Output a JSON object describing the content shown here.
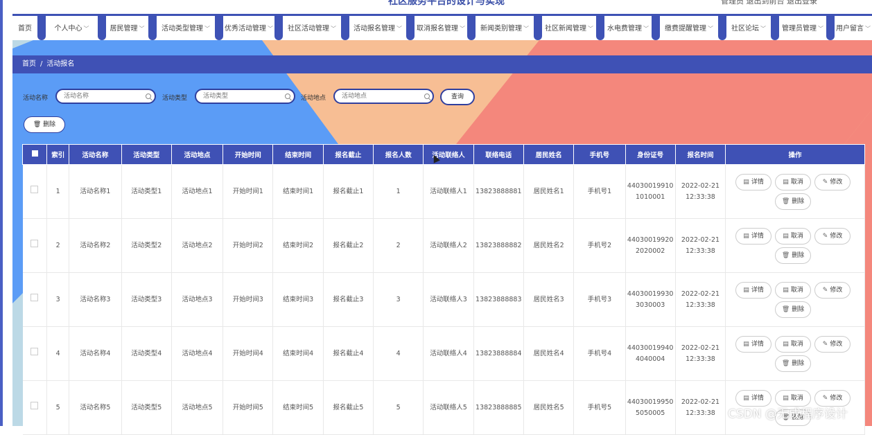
{
  "header": {
    "site_title": "社区服务平台的设计与实现",
    "top_right": "管理员   退出到前台   退出登录"
  },
  "nav": [
    {
      "label": "首页"
    },
    {
      "label": "个人中心"
    },
    {
      "label": "居民管理"
    },
    {
      "label": "活动类型管理"
    },
    {
      "label": "优秀活动管理"
    },
    {
      "label": "社区活动管理"
    },
    {
      "label": "活动报名管理"
    },
    {
      "label": "取消报名管理"
    },
    {
      "label": "新闻类别管理"
    },
    {
      "label": "社区新闻管理"
    },
    {
      "label": "水电费管理"
    },
    {
      "label": "缴费提醒管理"
    },
    {
      "label": "社区论坛"
    },
    {
      "label": "管理员管理"
    },
    {
      "label": "用户留言"
    }
  ],
  "breadcrumb": {
    "home": "首页",
    "separator": "/",
    "current": "活动报名"
  },
  "filters": {
    "name_label": "活动名称",
    "name_placeholder": "活动名称",
    "type_label": "活动类型",
    "type_placeholder": "活动类型",
    "place_label": "活动地点",
    "place_placeholder": "活动地点",
    "query_label": "查询"
  },
  "bulk": {
    "delete_label": "删除"
  },
  "table": {
    "headers": [
      "索引",
      "活动名称",
      "活动类型",
      "活动地点",
      "开始时间",
      "结束时间",
      "报名截止",
      "报名人数",
      "活动联络人",
      "联络电话",
      "居民姓名",
      "手机号",
      "身份证号",
      "报名时间",
      "操作"
    ],
    "rows": [
      [
        "1",
        "活动名称1",
        "活动类型1",
        "活动地点1",
        "开始时间1",
        "结束时间1",
        "报名截止1",
        "1",
        "活动联络人1",
        "13823888881",
        "居民姓名1",
        "手机号1",
        "440300199101010001",
        "2022-02-21 12:33:38"
      ],
      [
        "2",
        "活动名称2",
        "活动类型2",
        "活动地点2",
        "开始时间2",
        "结束时间2",
        "报名截止2",
        "2",
        "活动联络人2",
        "13823888882",
        "居民姓名2",
        "手机号2",
        "440300199202020002",
        "2022-02-21 12:33:38"
      ],
      [
        "3",
        "活动名称3",
        "活动类型3",
        "活动地点3",
        "开始时间3",
        "结束时间3",
        "报名截止3",
        "3",
        "活动联络人3",
        "13823888883",
        "居民姓名3",
        "手机号3",
        "440300199303030003",
        "2022-02-21 12:33:38"
      ],
      [
        "4",
        "活动名称4",
        "活动类型4",
        "活动地点4",
        "开始时间4",
        "结束时间4",
        "报名截止4",
        "4",
        "活动联络人4",
        "13823888884",
        "居民姓名4",
        "手机号4",
        "440300199404040004",
        "2022-02-21 12:33:38"
      ],
      [
        "5",
        "活动名称5",
        "活动类型5",
        "活动地点5",
        "开始时间5",
        "结束时间5",
        "报名截止5",
        "5",
        "活动联络人5",
        "13823888885",
        "居民姓名5",
        "手机号5",
        "440300199505050005",
        "2022-02-21 12:33:38"
      ]
    ],
    "actions": {
      "detail": "详情",
      "cancel": "取消",
      "edit": "修改",
      "delete": "删除"
    }
  },
  "watermark": "CSDN @无成程序设计",
  "colors": {
    "primary": "#3f51b5",
    "bg_blue": "#5b9cf6",
    "bg_peach": "#f7be94",
    "bg_salmon": "#f4877c"
  }
}
